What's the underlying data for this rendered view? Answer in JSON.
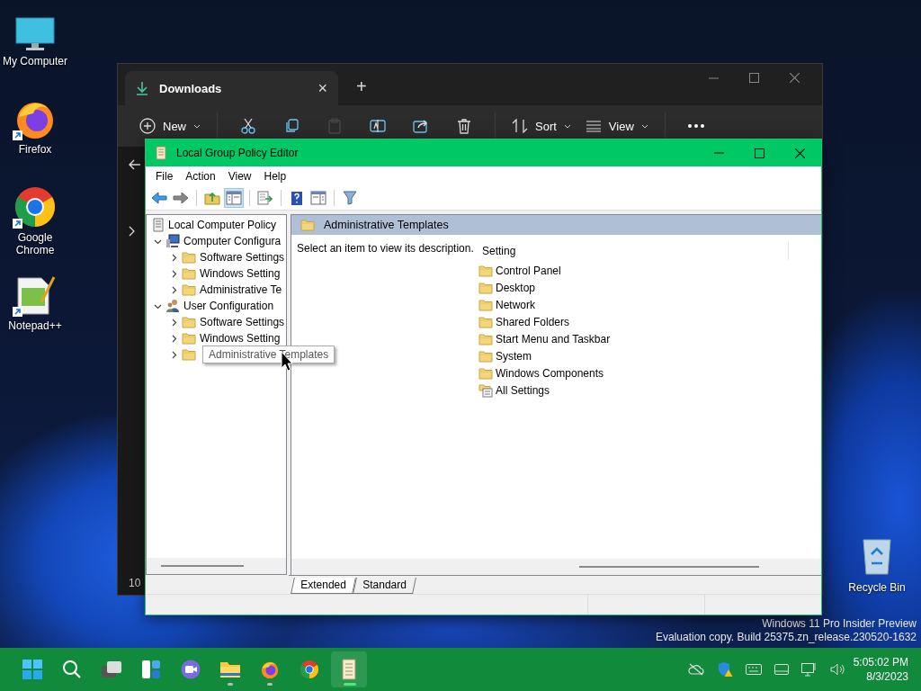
{
  "desktop_icons": [
    {
      "kind": "computer",
      "label": "My Computer",
      "shortcut": false
    },
    {
      "kind": "firefox",
      "label": "Firefox",
      "shortcut": true
    },
    {
      "kind": "chrome",
      "label": "Google Chrome",
      "shortcut": true
    },
    {
      "kind": "notepad",
      "label": "Notepad++",
      "shortcut": true
    }
  ],
  "recycle_bin": {
    "label": "Recycle Bin"
  },
  "explorer": {
    "tab": {
      "title": "Downloads",
      "close": "×"
    },
    "new_tab": "+",
    "toolbar": [
      {
        "kind": "new",
        "label": "New",
        "disabled": false
      },
      {
        "kind": "cut",
        "disabled": false
      },
      {
        "kind": "copy",
        "disabled": false
      },
      {
        "kind": "paste",
        "disabled": true
      },
      {
        "kind": "rename",
        "disabled": false
      },
      {
        "kind": "share",
        "disabled": false
      },
      {
        "kind": "delete",
        "disabled": false
      },
      {
        "kind": "sort",
        "label": "Sort",
        "disabled": false
      },
      {
        "kind": "view",
        "label": "View",
        "disabled": false
      },
      {
        "kind": "more",
        "disabled": false
      }
    ],
    "status_text": "10"
  },
  "gpe": {
    "title": "Local Group Policy Editor",
    "menu": [
      "File",
      "Action",
      "View",
      "Help"
    ],
    "toolbar": [
      {
        "kind": "back",
        "pressed": false
      },
      {
        "kind": "forward",
        "pressed": false
      },
      {
        "kind": "up",
        "pressed": false
      },
      {
        "kind": "tree-toggle",
        "pressed": true
      },
      {
        "kind": "export",
        "pressed": false
      },
      {
        "kind": "help",
        "pressed": false
      },
      {
        "kind": "action-pane",
        "pressed": false
      },
      {
        "kind": "filter",
        "pressed": false
      }
    ],
    "tree": {
      "label": "Local Computer Policy",
      "children": [
        {
          "kind": "computer",
          "label": "Computer Configura",
          "expanded": true,
          "children": [
            {
              "kind": "folder",
              "label": "Software Settings",
              "expanded": false
            },
            {
              "kind": "folder",
              "label": "Windows Setting",
              "expanded": false
            },
            {
              "kind": "folder",
              "label": "Administrative Te",
              "expanded": false
            }
          ]
        },
        {
          "kind": "user",
          "label": "User Configuration",
          "expanded": true,
          "children": [
            {
              "kind": "folder",
              "label": "Software Settings",
              "expanded": false
            },
            {
              "kind": "folder",
              "label": "Windows Setting",
              "expanded": false
            },
            {
              "kind": "folder",
              "tooltip": "Administrative Templates",
              "expanded": false
            }
          ]
        }
      ]
    },
    "header": "Administrative Templates",
    "description": "Select an item to view its description.",
    "column": "Setting",
    "items": [
      {
        "kind": "folder",
        "label": "Control Panel"
      },
      {
        "kind": "folder",
        "label": "Desktop"
      },
      {
        "kind": "folder",
        "label": "Network"
      },
      {
        "kind": "folder",
        "label": "Shared Folders"
      },
      {
        "kind": "folder",
        "label": "Start Menu and Taskbar"
      },
      {
        "kind": "folder",
        "label": "System"
      },
      {
        "kind": "folder",
        "label": "Windows Components"
      },
      {
        "kind": "settings",
        "label": "All Settings"
      }
    ],
    "tabs": [
      {
        "label": "Extended",
        "selected": true
      },
      {
        "label": "Standard",
        "selected": false
      }
    ]
  },
  "edition_notice": [
    "Windows 11 Pro Insider Preview",
    "Evaluation copy. Build 25375.zn_release.230520-1632"
  ],
  "taskbar": {
    "apps": [
      {
        "kind": "start",
        "running": false,
        "active": false
      },
      {
        "kind": "search",
        "running": false,
        "active": false
      },
      {
        "kind": "task-view",
        "running": false,
        "active": false
      },
      {
        "kind": "widgets",
        "running": false,
        "active": false
      },
      {
        "kind": "chat",
        "running": false,
        "active": false
      },
      {
        "kind": "files",
        "running": true,
        "active": false
      },
      {
        "kind": "firefox",
        "running": true,
        "active": false
      },
      {
        "kind": "chrome",
        "running": false,
        "active": false
      },
      {
        "kind": "policy",
        "running": true,
        "active": true
      }
    ],
    "time": "5:05:02 PM",
    "date": "8/3/2023"
  }
}
